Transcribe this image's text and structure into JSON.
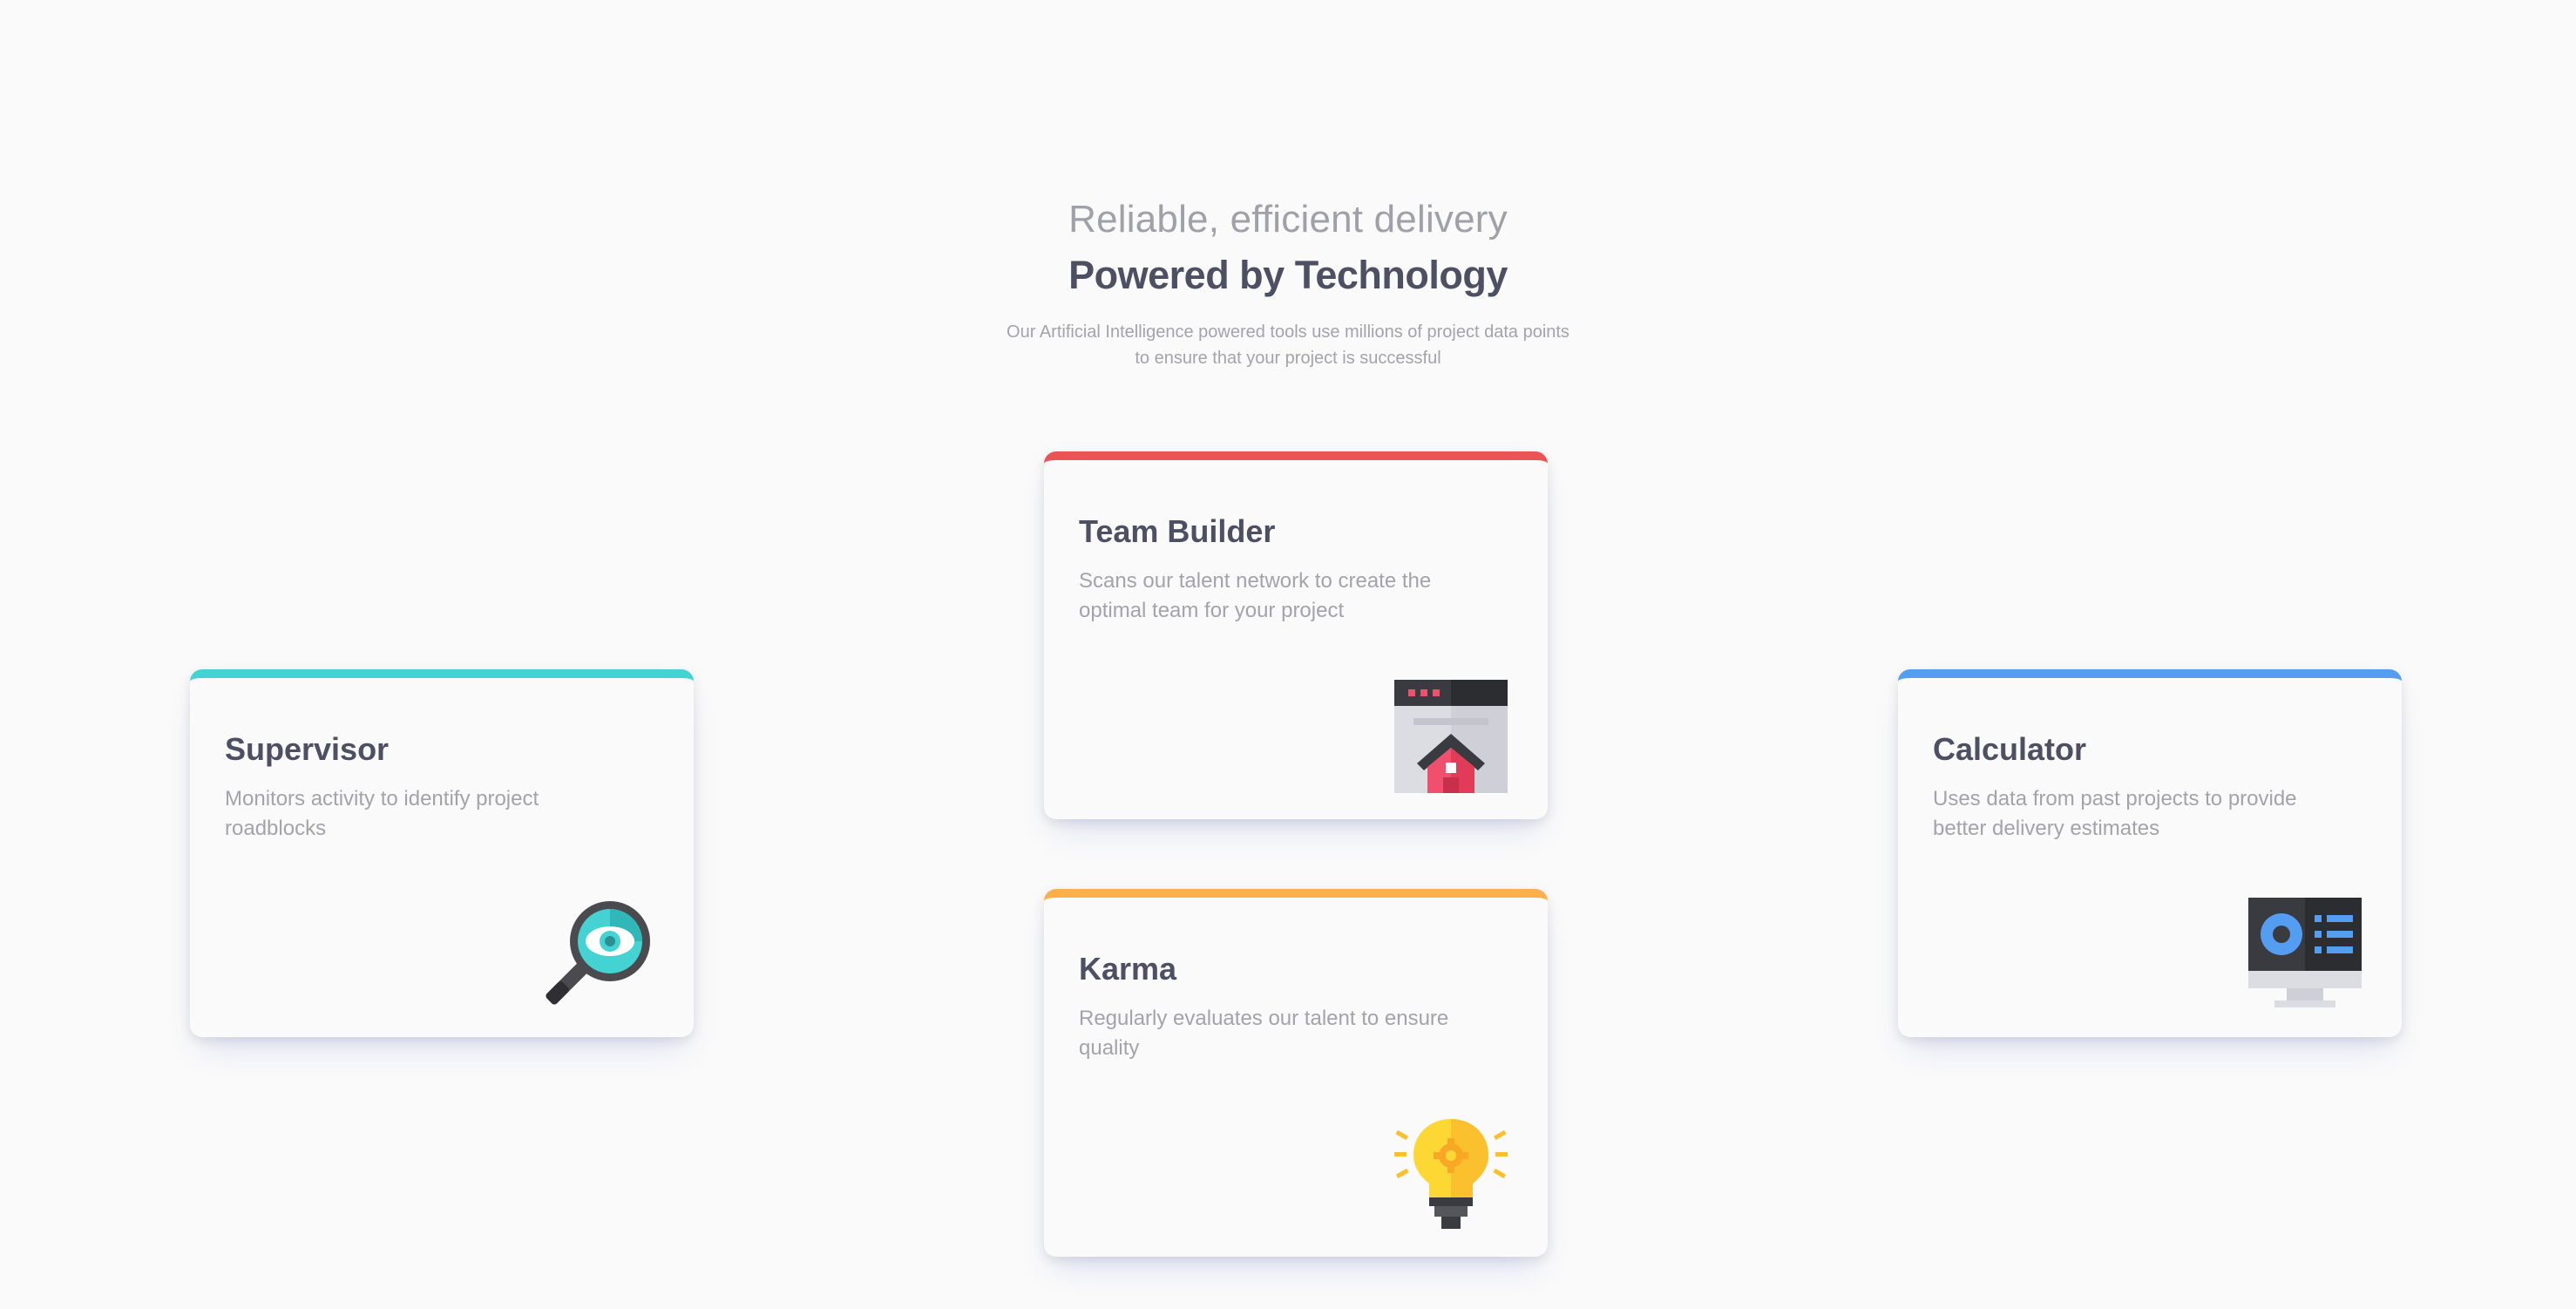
{
  "header": {
    "subtitle": "Reliable, efficient delivery",
    "title": "Powered by Technology",
    "description": "Our Artificial Intelligence powered tools use millions of project data points to ensure that your project is successful"
  },
  "cards": [
    {
      "title": "Supervisor",
      "description": "Monitors activity to identify project roadblocks",
      "accent": "#44d3d2",
      "icon": "magnifier-eye-icon"
    },
    {
      "title": "Team Builder",
      "description": "Scans our talent network to create the optimal team for your project",
      "accent": "#ea5454",
      "icon": "browser-house-icon"
    },
    {
      "title": "Karma",
      "description": "Regularly evaluates our talent to ensure quality",
      "accent": "#fcaf4a",
      "icon": "lightbulb-gear-icon"
    },
    {
      "title": "Calculator",
      "description": "Uses data from past projects to provide better delivery estimates",
      "accent": "#549ef2",
      "icon": "monitor-chart-icon"
    }
  ],
  "colors": {
    "background": "#fafafa",
    "heading": "#4d4f62",
    "muted": "#a3a3aa"
  }
}
